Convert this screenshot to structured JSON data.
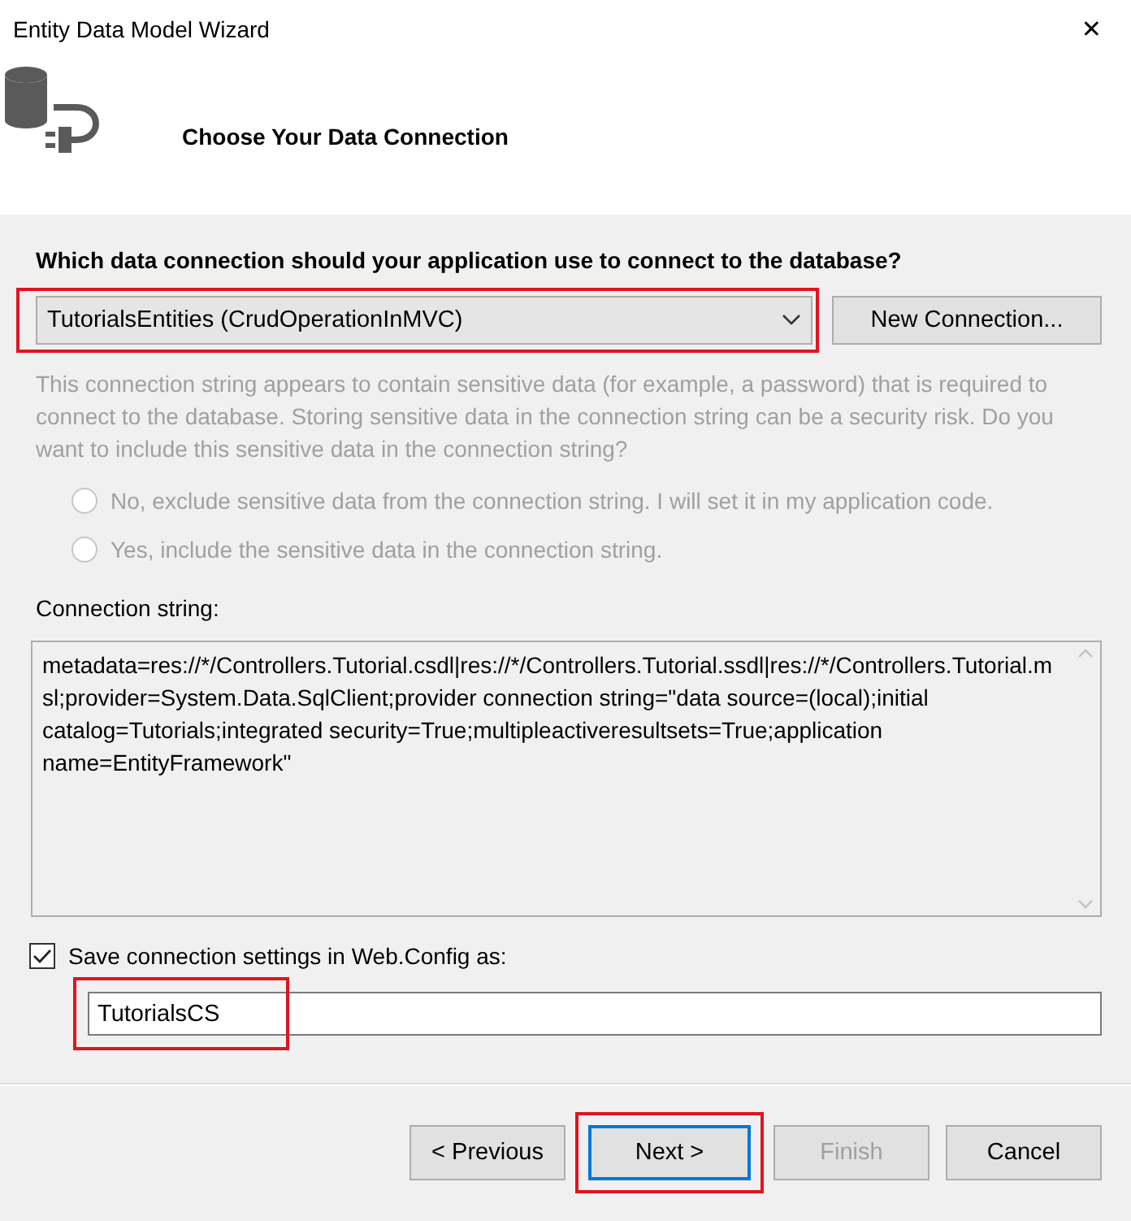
{
  "window": {
    "title": "Entity Data Model Wizard",
    "close": "✕"
  },
  "header": {
    "title": "Choose Your Data Connection"
  },
  "question": "Which data connection should your application use to connect to the database?",
  "connection": {
    "value": "TutorialsEntities (CrudOperationInMVC)",
    "highlighted": true
  },
  "new_connection_button": "New Connection...",
  "warning": {
    "text": "This connection string appears to contain sensitive data (for example, a password) that is required to connect to the database. Storing sensitive data in the connection string can be a security risk. Do you want to include this sensitive data in the connection string?",
    "disabled": true
  },
  "radios": [
    {
      "label": "No, exclude sensitive data from the connection string. I will set it in my application code.",
      "selected": false,
      "disabled": true
    },
    {
      "label": "Yes, include the sensitive data in the connection string.",
      "selected": false,
      "disabled": true
    }
  ],
  "connection_string": {
    "label": "Connection string:",
    "value": "metadata=res://*/Controllers.Tutorial.csdl|res://*/Controllers.Tutorial.ssdl|res://*/Controllers.Tutorial.msl;provider=System.Data.SqlClient;provider connection string=\"data source=(local);initial catalog=Tutorials;integrated security=True;multipleactiveresultsets=True;application name=EntityFramework\""
  },
  "save_settings": {
    "label": "Save connection settings in Web.Config as:",
    "checked": true
  },
  "settings_name": {
    "value": "TutorialsCS",
    "highlighted": true
  },
  "buttons": [
    {
      "label": "< Previous",
      "kind": "normal",
      "disabled": false,
      "highlighted": false
    },
    {
      "label": "Next >",
      "kind": "default",
      "disabled": false,
      "highlighted": true
    },
    {
      "label": "Finish",
      "kind": "normal",
      "disabled": true,
      "highlighted": false
    },
    {
      "label": "Cancel",
      "kind": "normal",
      "disabled": false,
      "highlighted": false
    }
  ]
}
